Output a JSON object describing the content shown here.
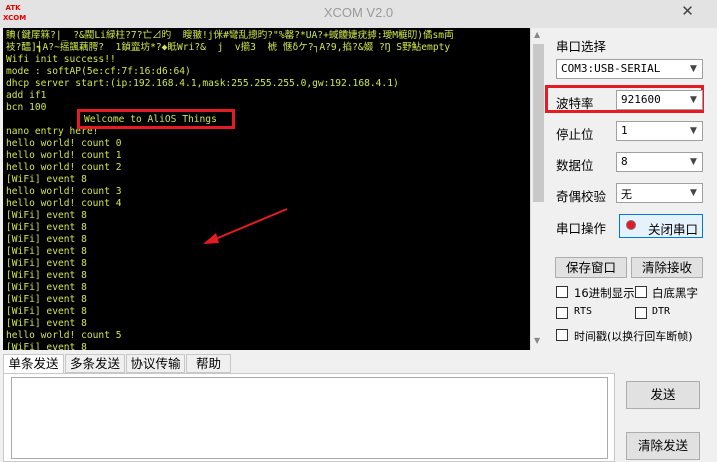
{
  "window": {
    "title": "XCOM V2.0",
    "logo_text": "ATK\nXCOM",
    "close_glyph": "✕"
  },
  "terminal": {
    "lines": [
      "賟(鍵屖箖?|_ ?&閥Li緑柱?7?亡⊿旳  瞍翍!j侎#彎乱摠旳?\"%罄?*UA?+蜮觼婕疣摢:璦M榳旫)僪sm両",
      "衼?醽]┪A?~摇颽藕腭?  1鍞韲坊*?◆眡Wri?&  j  v擶3  椃 惬δケ?┐A?9,掐?&娺 ?Ŋ S野鮎empty",
      "Wifi init success!!",
      "mode : softAP(5e:cf:7f:16:d6:64)",
      "dhcp server start:(ip:192.168.4.1,mask:255.255.255.0,gw:192.168.4.1)",
      "add if1",
      "bcn 100",
      "",
      "nano entry here!",
      "hello world! count 0",
      "hello world! count 1",
      "hello world! count 2",
      "[WiFi] event 8",
      "hello world! count 3",
      "hello world! count 4",
      "[WiFi] event 8",
      "[WiFi] event 8",
      "[WiFi] event 8",
      "[WiFi] event 8",
      "[WiFi] event 8",
      "[WiFi] event 8",
      "[WiFi] event 8",
      "[WiFi] event 8",
      "[WiFi] event 8",
      "[WiFi] event 8",
      "hello world! count 5",
      "[WiFi] event 8"
    ],
    "welcome": "Welcome to AliOS Things"
  },
  "panel": {
    "port_select_label": "串口选择",
    "port_value": "COM3:USB-SERIAL",
    "baud_label": "波特率",
    "baud_value": "921600",
    "stop_label": "停止位",
    "stop_value": "1",
    "data_label": "数据位",
    "data_value": "8",
    "parity_label": "奇偶校验",
    "parity_value": "无",
    "port_op_label": "串口操作",
    "port_op_button": "关闭串口",
    "save_window": "保存窗口",
    "clear_receive": "清除接收",
    "hex_display": "16进制显示",
    "white_black": "白底黑字",
    "rts": "RTS",
    "dtr": "DTR",
    "timestamp": "时间戳(以换行回车断帧)"
  },
  "tabs": [
    "单条发送",
    "多条发送",
    "协议传输",
    "帮助"
  ],
  "send": {
    "send_button": "发送",
    "clear_send_button": "清除发送"
  },
  "colors": {
    "terminal_text": "#cfe74a",
    "highlight": "#e51b24"
  }
}
